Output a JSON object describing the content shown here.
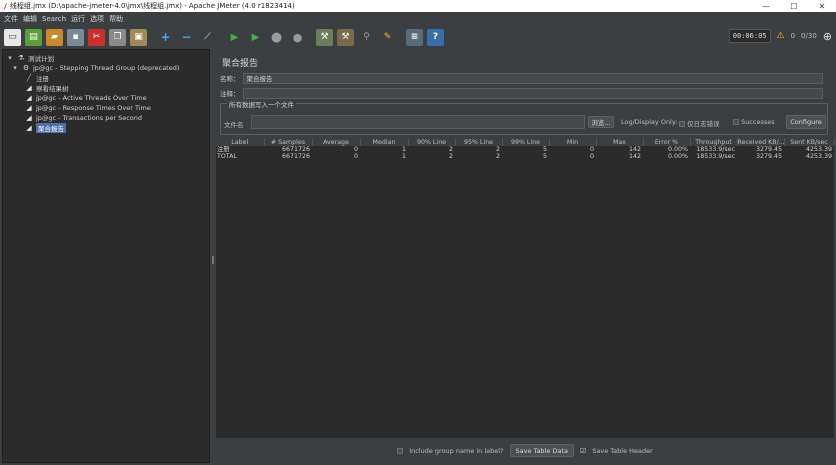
{
  "window": {
    "title": "线程组.jmx (D:\\apache-jmeter-4.0\\jmx\\线程组.jmx) - Apache JMeter (4.0 r1823414)",
    "min": "—",
    "max": "☐",
    "close": "✕"
  },
  "menu": [
    "文件",
    "编辑",
    "Search",
    "运行",
    "选项",
    "帮助"
  ],
  "toolbar": {
    "timer": "00:06:05",
    "warnings": "0",
    "threads": "0/30",
    "colors": {
      "accent": "#4b6eaf",
      "start": "#3cb043",
      "stop": "#9a9a9a"
    }
  },
  "tree": {
    "items": [
      {
        "label": "测试计划",
        "icon": "test-plan-icon"
      },
      {
        "label": "jp@gc - Stepping Thread Group (deprecated)",
        "icon": "thread-group-icon"
      },
      {
        "label": "注册",
        "icon": "sampler-icon"
      },
      {
        "label": "察看结果树",
        "icon": "listener-icon"
      },
      {
        "label": "jp@gc - Active Threads Over Time",
        "icon": "listener-icon"
      },
      {
        "label": "jp@gc - Response Times Over Time",
        "icon": "listener-icon"
      },
      {
        "label": "jp@gc - Transactions per Second",
        "icon": "listener-icon"
      },
      {
        "label": "聚合报告",
        "icon": "listener-icon"
      }
    ]
  },
  "panel": {
    "title": "聚合报告",
    "name_label": "名称：",
    "name_value": "聚合报告",
    "comment_label": "注释：",
    "comment_value": "",
    "file_legend": "所有数据写入一个文件",
    "file_label": "文件名",
    "browse": "浏览...",
    "log_display": "Log/Display Only:",
    "errors_only": "仅日志错误",
    "successes": "Successes",
    "configure": "Configure"
  },
  "table": {
    "headers": [
      "Label",
      "# Samples",
      "Average",
      "Median",
      "90% Line",
      "95% Line",
      "99% Line",
      "Min",
      "Max",
      "Error %",
      "Throughput",
      "Received KB/...",
      "Sent KB/sec"
    ],
    "rows": [
      [
        "注册",
        "6671726",
        "0",
        "1",
        "2",
        "2",
        "5",
        "0",
        "142",
        "0.00%",
        "18533.9/sec",
        "3279.45",
        "4253.39"
      ],
      [
        "TOTAL",
        "6671726",
        "0",
        "1",
        "2",
        "2",
        "5",
        "0",
        "142",
        "0.00%",
        "18533.9/sec",
        "3279.45",
        "4253.39"
      ]
    ]
  },
  "bottom": {
    "include_group": "Include group name in label?",
    "save_data": "Save Table Data",
    "save_header": "Save Table Header"
  }
}
